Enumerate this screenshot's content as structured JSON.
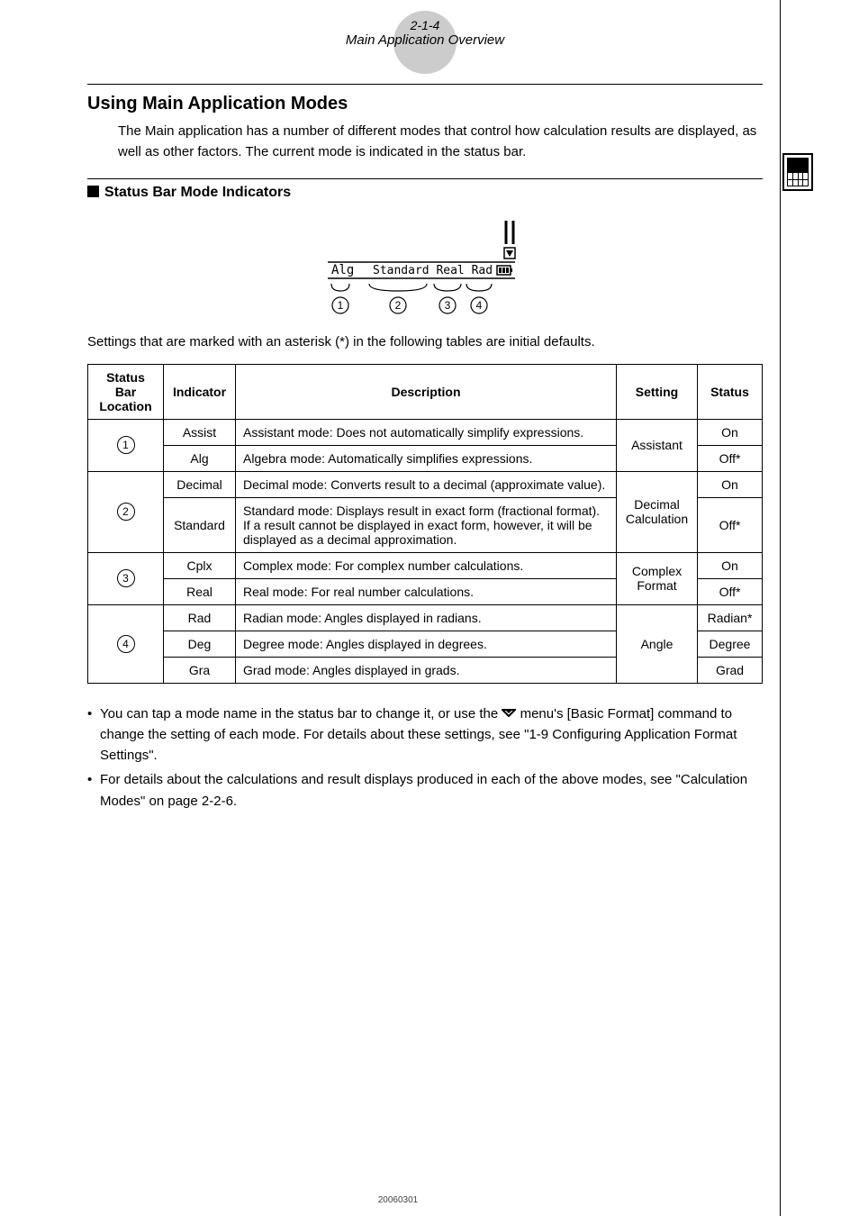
{
  "header": {
    "pagenum": "2-1-4",
    "title": "Main Application Overview"
  },
  "section": {
    "heading": "Using Main Application Modes",
    "intro": "The Main application has a number of different modes that control how calculation results are displayed, as well as other factors. The current mode is indicated in the status bar."
  },
  "sub": {
    "heading": "Status Bar Mode Indicators"
  },
  "statusbar_fig": {
    "label_alg": "Alg",
    "label_full": "Standard Real Rad",
    "markers": [
      "1",
      "2",
      "3",
      "4"
    ]
  },
  "defaults_note": "Settings that are marked with an asterisk (*) in the following tables are initial defaults.",
  "table": {
    "headers": {
      "loc": "Status Bar Location",
      "ind": "Indicator",
      "desc": "Description",
      "set": "Setting",
      "stat": "Status"
    },
    "rows": [
      {
        "loc": "1",
        "ind": "Assist",
        "desc": "Assistant mode: Does not automatically simplify expressions.",
        "set": "Assistant",
        "stat": "On"
      },
      {
        "loc": "",
        "ind": "Alg",
        "desc": "Algebra mode: Automatically simplifies expressions.",
        "set": "",
        "stat": "Off*"
      },
      {
        "loc": "2",
        "ind": "Decimal",
        "desc": "Decimal mode: Converts result to a decimal (approximate value).",
        "set": "Decimal Calculation",
        "stat": "On"
      },
      {
        "loc": "",
        "ind": "Standard",
        "desc": "Standard mode: Displays result in exact form (fractional format). If a result cannot be displayed in exact form, however, it will be displayed as a decimal approximation.",
        "set": "",
        "stat": "Off*"
      },
      {
        "loc": "3",
        "ind": "Cplx",
        "desc": "Complex mode: For complex number calculations.",
        "set": "Complex Format",
        "stat": "On"
      },
      {
        "loc": "",
        "ind": "Real",
        "desc": "Real mode: For real number calculations.",
        "set": "",
        "stat": "Off*"
      },
      {
        "loc": "4",
        "ind": "Rad",
        "desc": "Radian mode: Angles displayed in radians.",
        "set": "Angle",
        "stat": "Radian*"
      },
      {
        "loc": "",
        "ind": "Deg",
        "desc": "Degree mode: Angles displayed in degrees.",
        "set": "",
        "stat": "Degree"
      },
      {
        "loc": "",
        "ind": "Gra",
        "desc": "Grad mode: Angles displayed in grads.",
        "set": "",
        "stat": "Grad"
      }
    ]
  },
  "bullets": {
    "b1a": "You can tap a mode name in the status bar to change it, or use the ",
    "b1b": " menu's [Basic Format] command to change the setting of each mode. For details about these settings, see \"1-9 Configuring Application Format Settings\".",
    "b2": "For details about the calculations and result displays produced in each of the above modes, see \"Calculation Modes\" on page 2-2-6."
  },
  "footer_date": "20060301"
}
